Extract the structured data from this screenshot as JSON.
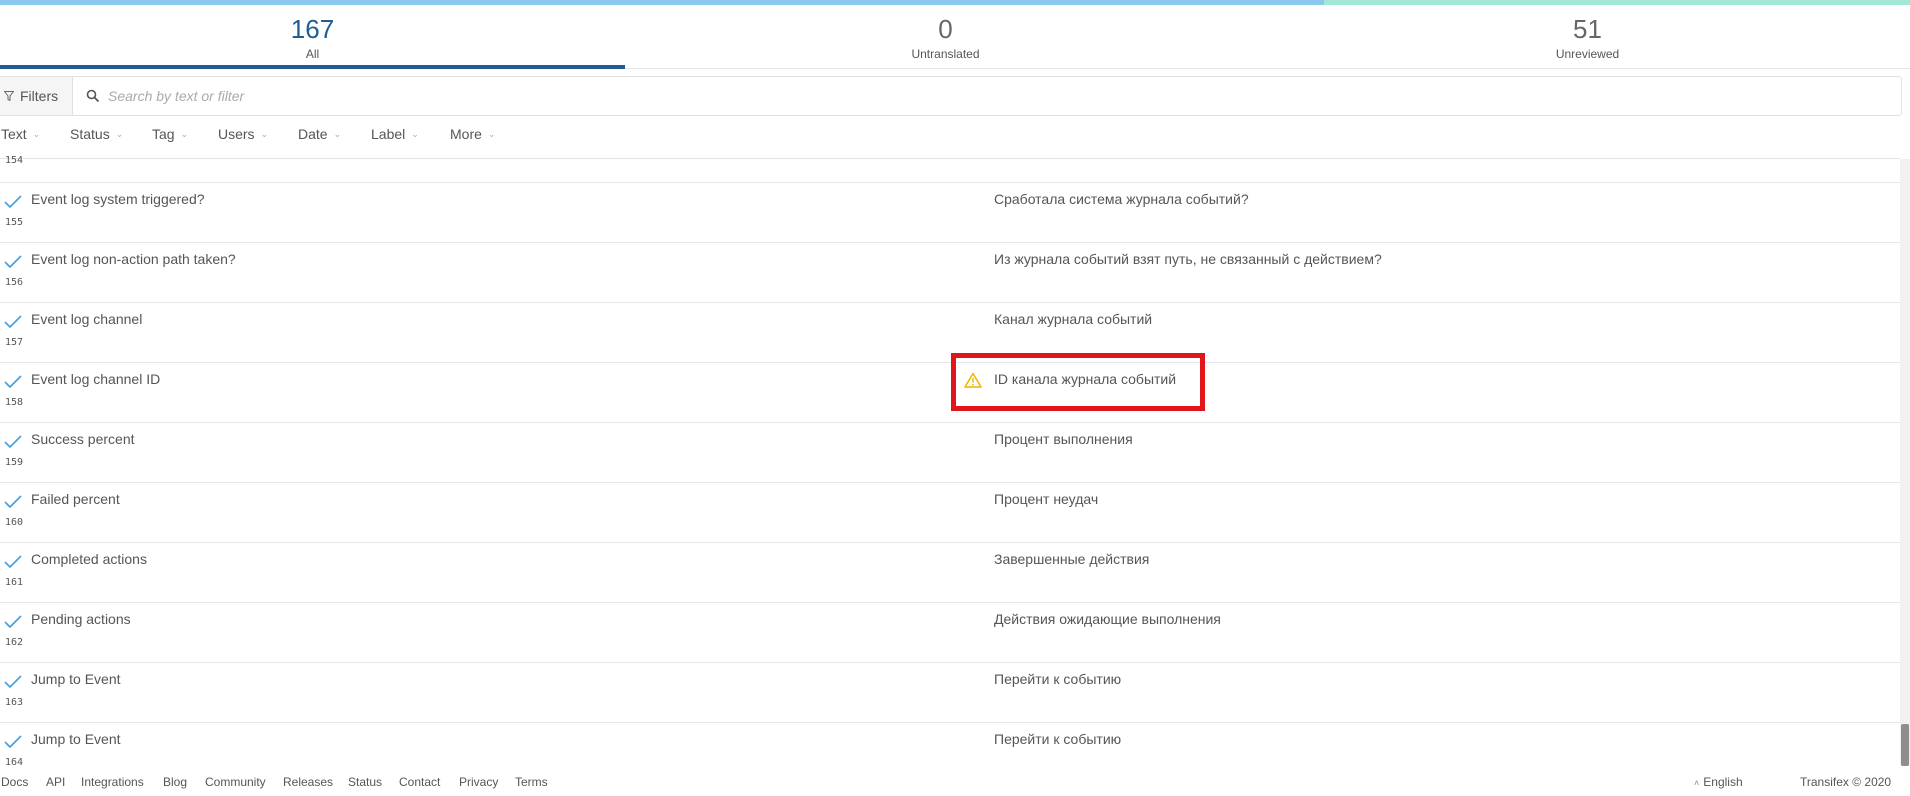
{
  "progress": {
    "reviewed_fraction": 0.693,
    "colors": {
      "reviewed": "#8cc8ee",
      "remaining": "#a2e8d6"
    }
  },
  "stats": [
    {
      "count": "167",
      "label": "All"
    },
    {
      "count": "0",
      "label": "Untranslated"
    },
    {
      "count": "51",
      "label": "Unreviewed"
    }
  ],
  "toolbar": {
    "filters_label": "Filters",
    "search_placeholder": "Search by text or filter"
  },
  "dropdowns": [
    "Text",
    "Status",
    "Tag",
    "Users",
    "Date",
    "Label",
    "More"
  ],
  "list": {
    "partial_index": "154",
    "rows": [
      {
        "source": "Event log system triggered?",
        "index": "155",
        "translation": "Сработала система журнала событий?"
      },
      {
        "source": "Event log non-action path taken?",
        "index": "156",
        "translation": "Из журнала событий взят путь, не связанный с действием?"
      },
      {
        "source": "Event log channel",
        "index": "157",
        "translation": "Канал журнала событий"
      },
      {
        "source": "Event log channel ID",
        "index": "158",
        "translation": "ID канала журнала событий",
        "warning": true,
        "highlighted": true
      },
      {
        "source": "Success percent",
        "index": "159",
        "translation": "Процент выполнения"
      },
      {
        "source": "Failed percent",
        "index": "160",
        "translation": "Процент неудач"
      },
      {
        "source": "Completed actions",
        "index": "161",
        "translation": "Завершенные действия"
      },
      {
        "source": "Pending actions",
        "index": "162",
        "translation": "Действия ожидающие выполнения"
      },
      {
        "source": "Jump to Event",
        "index": "163",
        "translation": "Перейти к событию"
      },
      {
        "source": "Jump to Event",
        "index": "164",
        "translation": "Перейти к событию"
      }
    ]
  },
  "footer": {
    "links": [
      "Docs",
      "API",
      "Integrations",
      "Blog",
      "Community",
      "Releases",
      "Status",
      "Contact",
      "Privacy",
      "Terms"
    ],
    "language": "English",
    "copyright": "Transifex © 2020"
  },
  "colors": {
    "accent": "#1f5d94",
    "check": "#4aa3df",
    "warning": "#f0b400",
    "highlight": "#e0161a"
  }
}
